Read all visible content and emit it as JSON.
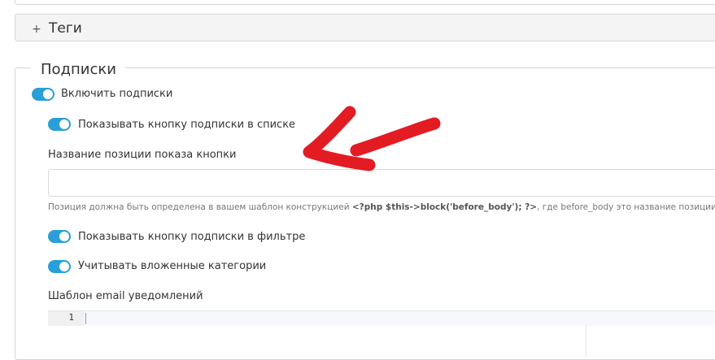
{
  "tags_panel": {
    "toggle_symbol": "+",
    "title": "Теги"
  },
  "subscriptions": {
    "legend": "Подписки",
    "enable_label": "Включить подписки",
    "enable_on": true,
    "show_in_list_label": "Показывать кнопку подписки в списке",
    "show_in_list_on": true,
    "position_name_label": "Название позиции показа кнопки",
    "position_name_value": "",
    "help": {
      "prefix": "Позиция должна быть определена в вашем шаблон конструкцией ",
      "code": "<?php $this->block('before_body'); ?>",
      "suffix": ", где before_body это название позиции"
    },
    "show_in_filter_label": "Показывать кнопку подписки в фильтре",
    "show_in_filter_on": true,
    "nested_categories_label": "Учитывать вложенные категории",
    "nested_categories_on": true,
    "email_template_label": "Шаблон email уведомлений",
    "editor_line_number": "1"
  },
  "colors": {
    "toggle_on": "#2a9fd6",
    "arrow": "#e31b23"
  },
  "icons": {
    "tags_expand": "plus-icon",
    "annotation": "red-arrow-icon"
  }
}
